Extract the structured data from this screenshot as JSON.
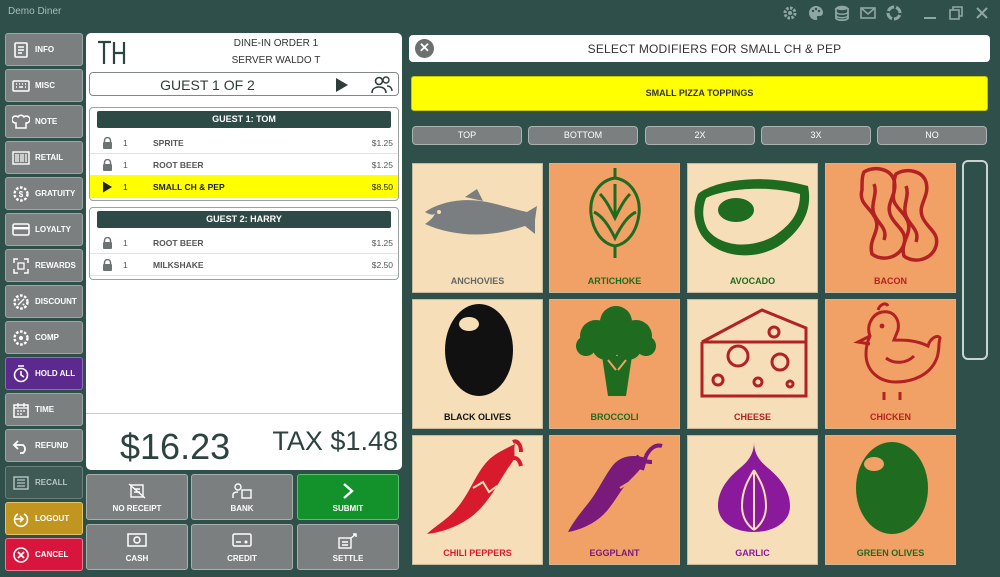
{
  "window": {
    "title": "Demo Diner"
  },
  "titlebar_icons": [
    "gear-icon",
    "palette-icon",
    "database-icon",
    "mail-icon",
    "lifebuoy-icon",
    "minimize-icon",
    "restore-icon",
    "close-icon"
  ],
  "sidebar": [
    {
      "label": "INFO",
      "icon": "info-icon",
      "style": ""
    },
    {
      "label": "MISC",
      "icon": "keyboard-icon",
      "style": ""
    },
    {
      "label": "NOTE",
      "icon": "chef-hat-icon",
      "style": ""
    },
    {
      "label": "RETAIL",
      "icon": "barcode-icon",
      "style": ""
    },
    {
      "label": "GRATUITY",
      "icon": "gear-dollar-icon",
      "style": ""
    },
    {
      "label": "LOYALTY",
      "icon": "card-icon",
      "style": ""
    },
    {
      "label": "REWARDS",
      "icon": "qr-icon",
      "style": ""
    },
    {
      "label": "DISCOUNT",
      "icon": "discount-icon",
      "style": ""
    },
    {
      "label": "COMP",
      "icon": "comp-icon",
      "style": ""
    },
    {
      "label": "HOLD ALL",
      "icon": "hold-clock-icon",
      "style": "purple"
    },
    {
      "label": "TIME",
      "icon": "calendar-icon",
      "style": ""
    },
    {
      "label": "REFUND",
      "icon": "refund-icon",
      "style": ""
    },
    {
      "label": "RECALL",
      "icon": "list-icon",
      "style": "dim"
    },
    {
      "label": "LOGOUT",
      "icon": "logout-icon",
      "style": "gold"
    },
    {
      "label": "CANCEL",
      "icon": "cancel-icon",
      "style": "red"
    }
  ],
  "order": {
    "logo": "TH",
    "type_line": "DINE-IN ORDER 1",
    "server_line": "SERVER WALDO T",
    "guest_selector": "GUEST 1 OF 2",
    "guests": [
      {
        "header": "GUEST 1: TOM",
        "items": [
          {
            "qty": "1",
            "name": "SPRITE",
            "price": "$1.25",
            "icon": "lock-icon",
            "selected": false
          },
          {
            "qty": "1",
            "name": "ROOT BEER",
            "price": "$1.25",
            "icon": "lock-icon",
            "selected": false
          },
          {
            "qty": "1",
            "name": "SMALL CH & PEP",
            "price": "$8.50",
            "icon": "play-icon",
            "selected": true
          }
        ]
      },
      {
        "header": "GUEST 2: HARRY",
        "items": [
          {
            "qty": "1",
            "name": "ROOT BEER",
            "price": "$1.25",
            "icon": "lock-icon",
            "selected": false
          },
          {
            "qty": "1",
            "name": "MILKSHAKE",
            "price": "$2.50",
            "icon": "lock-icon",
            "selected": false
          }
        ]
      }
    ],
    "total": "$16.23",
    "tax": "TAX $1.48"
  },
  "actions": [
    {
      "label": "NO RECEIPT",
      "icon": "no-receipt-icon",
      "style": ""
    },
    {
      "label": "BANK",
      "icon": "bank-icon",
      "style": ""
    },
    {
      "label": "SUBMIT",
      "icon": "submit-icon",
      "style": "green"
    },
    {
      "label": "CASH",
      "icon": "cash-icon",
      "style": ""
    },
    {
      "label": "CREDIT",
      "icon": "credit-icon",
      "style": ""
    },
    {
      "label": "SETTLE",
      "icon": "settle-icon",
      "style": ""
    }
  ],
  "modifiers": {
    "title": "SELECT MODIFIERS FOR SMALL CH & PEP",
    "category": "SMALL PIZZA TOPPINGS",
    "positions": [
      "TOP",
      "BOTTOM",
      "2X",
      "3X",
      "NO"
    ],
    "toppings": [
      {
        "label": "ANCHOVIES",
        "icon": "fish-icon",
        "bg": "cream",
        "color": "#666666"
      },
      {
        "label": "ARTICHOKE",
        "icon": "artichoke-icon",
        "bg": "orange",
        "color": "#1f6b1f"
      },
      {
        "label": "AVOCADO",
        "icon": "avocado-icon",
        "bg": "cream",
        "color": "#1f6b1f"
      },
      {
        "label": "BACON",
        "icon": "bacon-icon",
        "bg": "orange",
        "color": "#b22222"
      },
      {
        "label": "BLACK OLIVES",
        "icon": "olive-icon",
        "bg": "cream",
        "color": "#111111"
      },
      {
        "label": "BROCCOLI",
        "icon": "broccoli-icon",
        "bg": "orange",
        "color": "#1f6b1f"
      },
      {
        "label": "CHEESE",
        "icon": "cheese-icon",
        "bg": "cream",
        "color": "#b22222"
      },
      {
        "label": "CHICKEN",
        "icon": "chicken-icon",
        "bg": "orange",
        "color": "#b22222"
      },
      {
        "label": "CHILI PEPPERS",
        "icon": "chili-icon",
        "bg": "cream",
        "color": "#d81b2c"
      },
      {
        "label": "EGGPLANT",
        "icon": "eggplant-icon",
        "bg": "orange",
        "color": "#7a1a7a"
      },
      {
        "label": "GARLIC",
        "icon": "garlic-icon",
        "bg": "cream",
        "color": "#8a1a9b"
      },
      {
        "label": "GREEN OLIVES",
        "icon": "green-olive-icon",
        "bg": "orange",
        "color": "#1f6b1f"
      }
    ]
  }
}
